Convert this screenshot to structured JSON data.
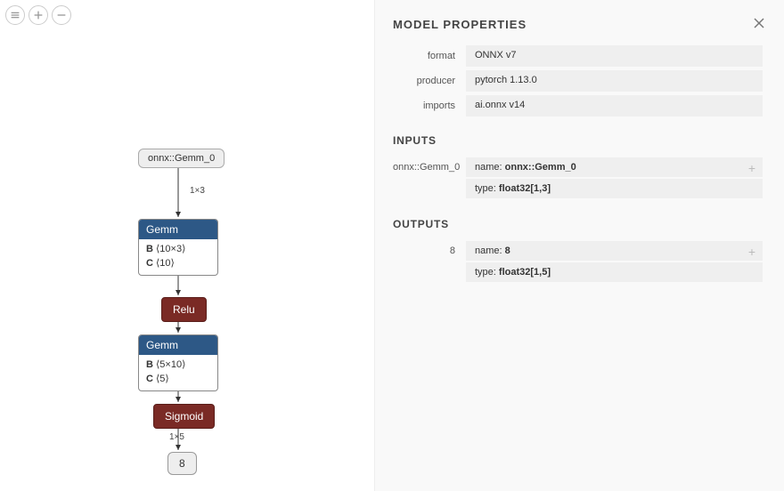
{
  "toolbar": {
    "menu": "menu-icon",
    "zoom_in": "plus-icon",
    "zoom_out": "minus-icon"
  },
  "graph": {
    "input_node": "onnx::Gemm_0",
    "edge1_label": "1×3",
    "gemm1": {
      "title": "Gemm",
      "line1_label": "B",
      "line1_dim": "⟨10×3⟩",
      "line2_label": "C",
      "line2_dim": "⟨10⟩"
    },
    "relu": "Relu",
    "gemm2": {
      "title": "Gemm",
      "line1_label": "B",
      "line1_dim": "⟨5×10⟩",
      "line2_label": "C",
      "line2_dim": "⟨5⟩"
    },
    "sigmoid": "Sigmoid",
    "edge_last_label": "1×5",
    "output_node": "8"
  },
  "panel": {
    "title": "MODEL PROPERTIES",
    "props": {
      "format_label": "format",
      "format_value": "ONNX v7",
      "producer_label": "producer",
      "producer_value": "pytorch 1.13.0",
      "imports_label": "imports",
      "imports_value": "ai.onnx v14"
    },
    "inputs_section": "INPUTS",
    "input": {
      "label": "onnx::Gemm_0",
      "name_key": "name:",
      "name_val": "onnx::Gemm_0",
      "type_key": "type:",
      "type_val": "float32[1,3]",
      "expand": "+"
    },
    "outputs_section": "OUTPUTS",
    "output": {
      "label": "8",
      "name_key": "name:",
      "name_val": "8",
      "type_key": "type:",
      "type_val": "float32[1,5]",
      "expand": "+"
    }
  }
}
